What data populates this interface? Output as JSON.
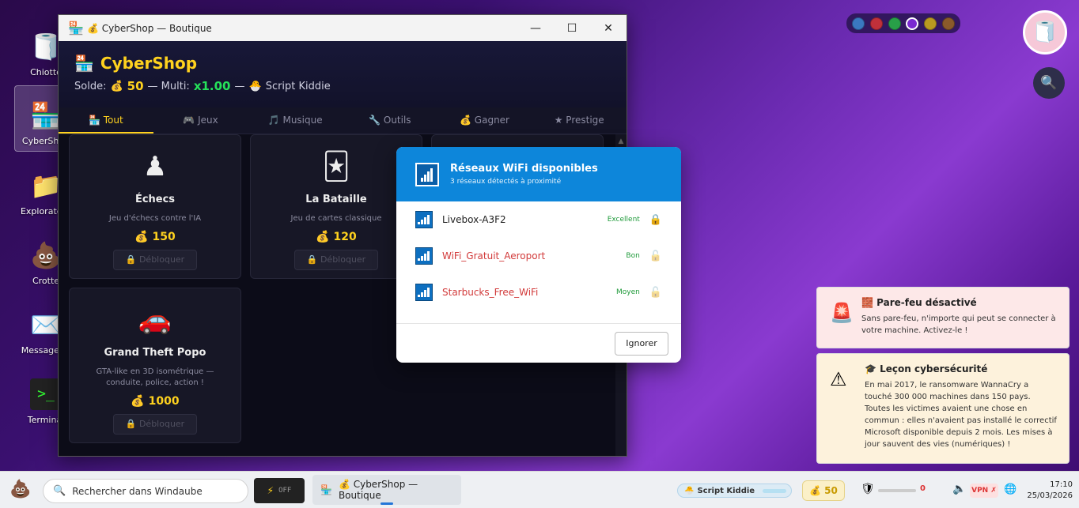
{
  "desktop": {
    "icons": [
      {
        "label": "Chiotte",
        "glyph": "🧻"
      },
      {
        "label": "CyberShop",
        "glyph": "🏪"
      },
      {
        "label": "Explorateur",
        "glyph": "📁"
      },
      {
        "label": "Crotte",
        "glyph": "💩"
      },
      {
        "label": "Messagerie",
        "glyph": "✉️"
      },
      {
        "label": "Terminal",
        "glyph": ">_"
      }
    ]
  },
  "window": {
    "title": "💰 CyberShop — Boutique",
    "controls": {
      "minimize": "—",
      "maximize": "☐",
      "close": "✕"
    }
  },
  "shop": {
    "title": "CyberShop",
    "balance_label": "Solde:",
    "balance": "50",
    "multi_label": "— Multi:",
    "multi": "x1.00",
    "sep": "—",
    "rank": "Script Kiddie"
  },
  "tabs": [
    {
      "label": "🏪 Tout"
    },
    {
      "label": "🎮 Jeux"
    },
    {
      "label": "🎵 Musique"
    },
    {
      "label": "🔧 Outils"
    },
    {
      "label": "💰 Gagner"
    },
    {
      "label": "★ Prestige"
    }
  ],
  "cards": [
    {
      "glyph": "♟",
      "name": "Échecs",
      "desc": "Jeu d'échecs contre l'IA",
      "price": "150",
      "button": "🔒 Débloquer"
    },
    {
      "glyph": "🃏",
      "name": "La Bataille",
      "desc": "Jeu de cartes classique",
      "price": "120",
      "button": "🔒 Débloquer"
    },
    {
      "glyph": "🚗",
      "name": "Grand Theft Popo",
      "desc": "GTA-like en 3D isométrique — conduite, police, action !",
      "price": "1000",
      "button": "🔒 Débloquer"
    }
  ],
  "wifi": {
    "title": "Réseaux WiFi disponibles",
    "subtitle": "3 réseaux détectés à proximité",
    "networks": [
      {
        "name": "Livebox-A3F2",
        "quality": "Excellent",
        "lock": "🔒"
      },
      {
        "name": "WiFi_Gratuit_Aeroport",
        "quality": "Bon",
        "lock": "🔓"
      },
      {
        "name": "Starbucks_Free_WiFi",
        "quality": "Moyen",
        "lock": "🔓"
      }
    ],
    "ignore_label": "Ignorer"
  },
  "colors": [
    "#3a78c0",
    "#c0303a",
    "#28a048",
    "#7a2ad0",
    "#b89a20",
    "#8a5a2a"
  ],
  "notifications": [
    {
      "icon": "🚨",
      "title": "🧱 Pare-feu désactivé",
      "body": "Sans pare-feu, n'importe qui peut se connecter à votre machine. Activez-le !"
    },
    {
      "icon": "⚠",
      "title": "🎓 Leçon cybersécurité",
      "body": "En mai 2017, le ransomware WannaCry a touché 300 000 machines dans 150 pays. Toutes les victimes avaient une chose en commun : elles n'avaient pas installé le correctif Microsoft disponible depuis 2 mois. Les mises à jour sauvent des vies (numériques) !"
    }
  ],
  "taskbar": {
    "search_placeholder": "Rechercher dans Windaube",
    "switch_label": "OFF",
    "app_label": "💰 CyberShop — Boutique",
    "rank": "Script Kiddie",
    "coins": "50",
    "threats": "0",
    "vpn": "VPN ✗",
    "time": "17:10",
    "date": "25/03/2026"
  }
}
